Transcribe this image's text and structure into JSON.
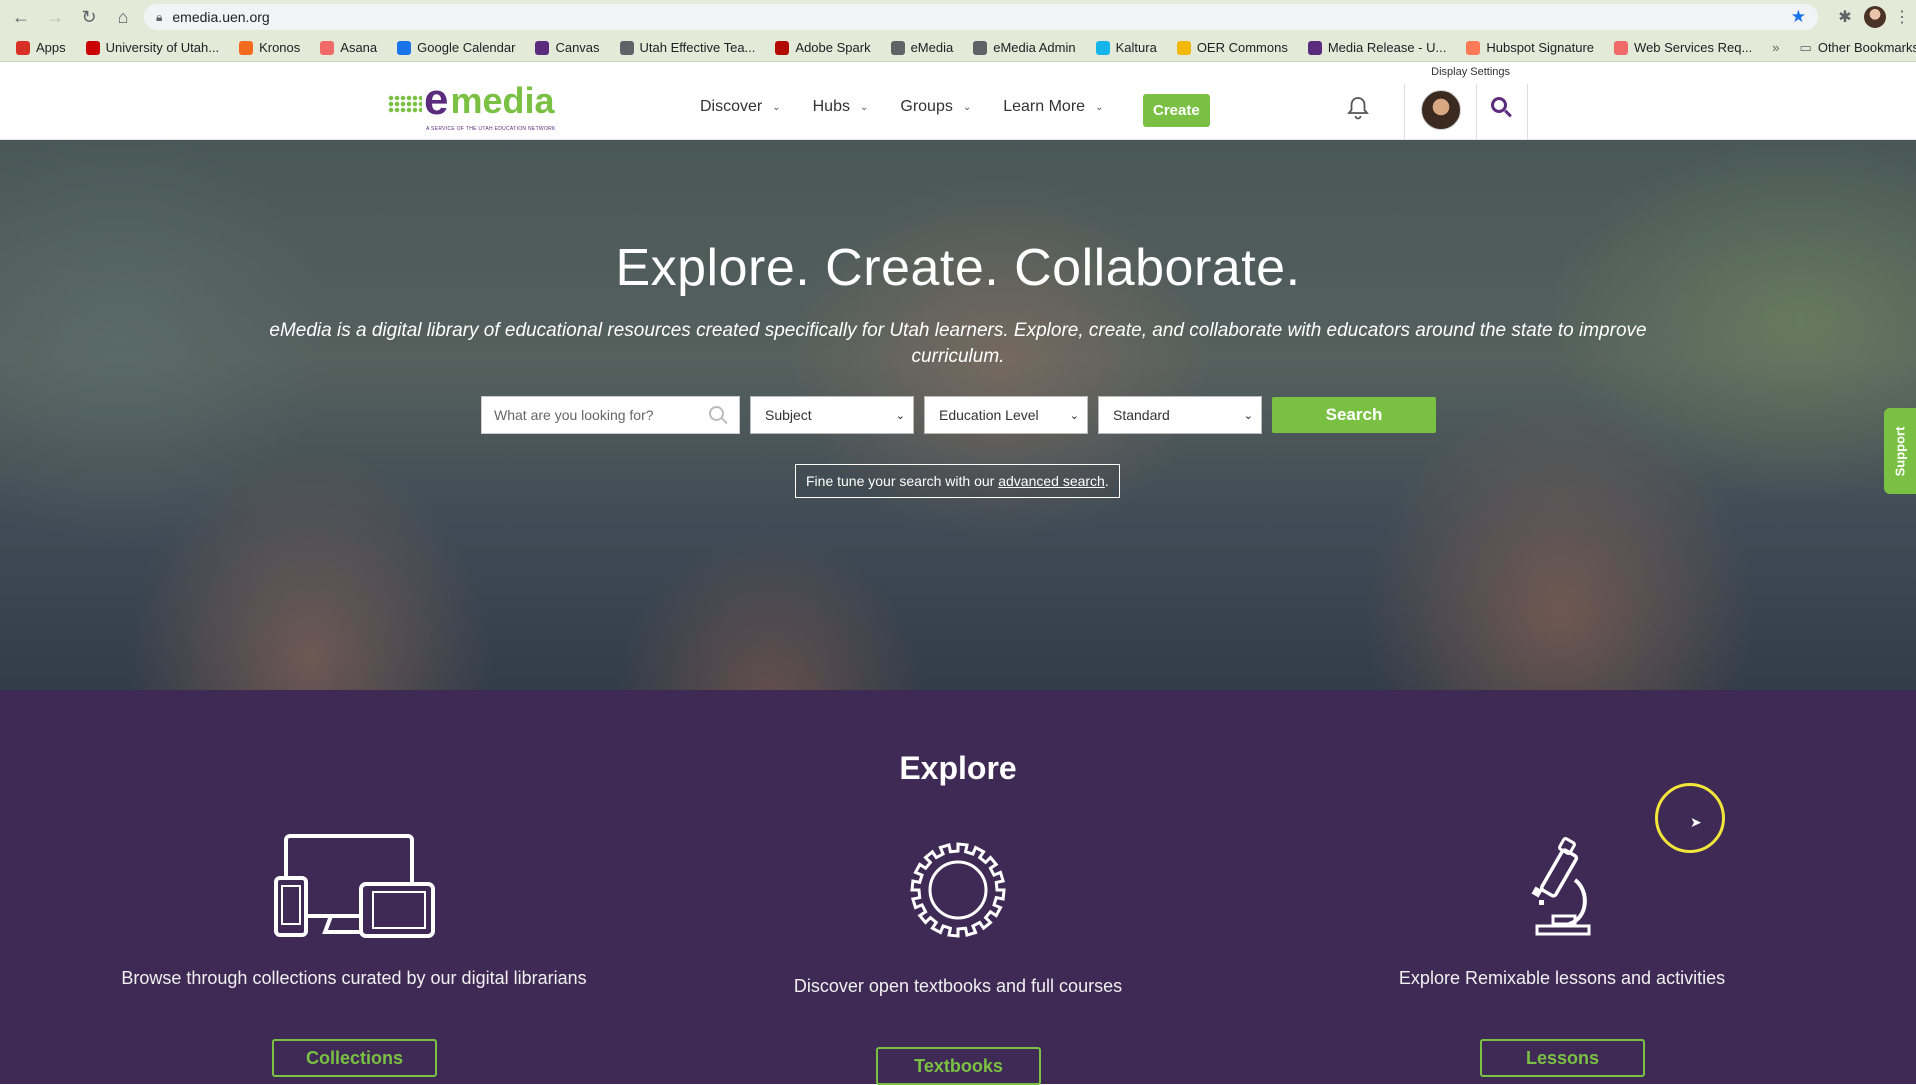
{
  "browser": {
    "url": "emedia.uen.org",
    "bookmarks": [
      {
        "label": "Apps",
        "color": "#d93025"
      },
      {
        "label": "University of Utah...",
        "color": "#cc0000"
      },
      {
        "label": "Kronos",
        "color": "#f26b21"
      },
      {
        "label": "Asana",
        "color": "#f06a6a"
      },
      {
        "label": "Google Calendar",
        "color": "#1a73e8"
      },
      {
        "label": "Canvas",
        "color": "#5b2c7e"
      },
      {
        "label": "Utah Effective Tea...",
        "color": "#5f6368"
      },
      {
        "label": "Adobe Spark",
        "color": "#b30b00"
      },
      {
        "label": "eMedia",
        "color": "#5f6368"
      },
      {
        "label": "eMedia Admin",
        "color": "#5f6368"
      },
      {
        "label": "Kaltura",
        "color": "#13b5ea"
      },
      {
        "label": "OER Commons",
        "color": "#f2b705"
      },
      {
        "label": "Media Release - U...",
        "color": "#5b2c7e"
      },
      {
        "label": "Hubspot Signature",
        "color": "#ff7a59"
      },
      {
        "label": "Web Services Req...",
        "color": "#f06a6a"
      }
    ],
    "more_label": "»",
    "other_bookmarks": "Other Bookmarks"
  },
  "header": {
    "display_settings": "Display Settings",
    "logo_e": "e",
    "logo_media": "media",
    "logo_tagline": "A SERVICE OF THE UTAH EDUCATION NETWORK",
    "nav": [
      {
        "label": "Discover"
      },
      {
        "label": "Hubs"
      },
      {
        "label": "Groups"
      },
      {
        "label": "Learn More"
      }
    ],
    "create_label": "Create"
  },
  "hero": {
    "title": "Explore. Create. Collaborate.",
    "subtitle": "eMedia is a digital library of educational resources created specifically for Utah learners. Explore, create, and collaborate with educators around the state to improve curriculum.",
    "search_placeholder": "What are you looking for?",
    "subject": "Subject",
    "education_level": "Education Level",
    "standard": "Standard",
    "search_button": "Search",
    "advanced_prefix": "Fine tune your search with our ",
    "advanced_link": "advanced search",
    "advanced_suffix": ".",
    "support": "Support"
  },
  "explore": {
    "title": "Explore",
    "columns": [
      {
        "desc": "Browse through collections curated by our digital librarians",
        "button": "Collections",
        "icon": "devices-icon"
      },
      {
        "desc": "Discover open textbooks and full courses",
        "button": "Textbooks",
        "icon": "gear-icon"
      },
      {
        "desc": "Explore Remixable lessons and activities",
        "button": "Lessons",
        "icon": "microscope-icon"
      }
    ]
  },
  "colors": {
    "brand_green": "#7ac143",
    "brand_purple": "#5b2c7e",
    "explore_bg": "#3f2a55"
  }
}
